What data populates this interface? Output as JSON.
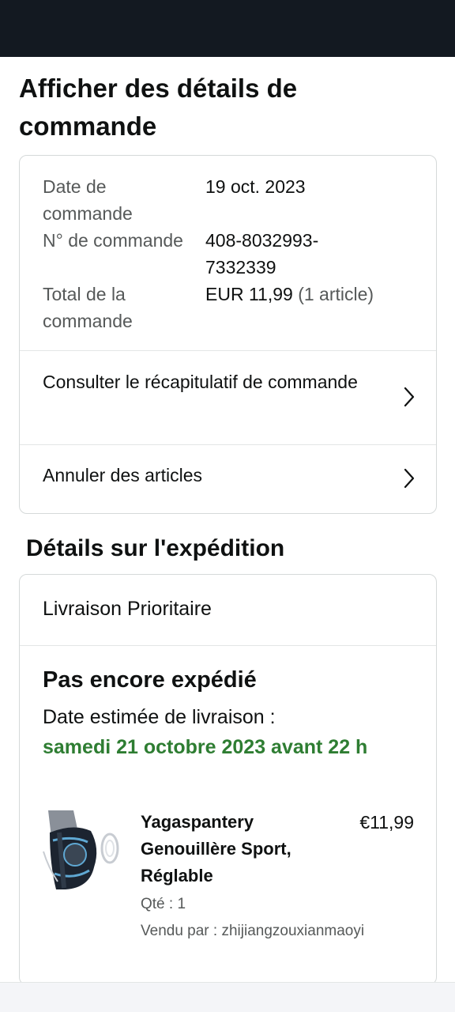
{
  "page_title": "Afficher des détails de commande",
  "summary": {
    "order_date_label": "Date de commande",
    "order_date": "19 oct. 2023",
    "order_number_label": "N° de commande",
    "order_number": "408-8032993-7332339",
    "total_label": "Total de la commande",
    "total_amount": "EUR 11,99",
    "total_items": "(1 article)"
  },
  "actions": {
    "recap_label": "Consulter le récapitulatif de commande",
    "cancel_label": "Annuler des articles"
  },
  "shipping": {
    "section_title": "Détails sur l'expédition",
    "method": "Livraison Prioritaire",
    "status": "Pas encore expédié",
    "estimate_label": "Date estimée de livraison :",
    "estimate_date": "samedi 21 octobre 2023 avant 22 h",
    "estimate_color": "#2e7d32"
  },
  "product": {
    "name": "Yagaspantery Genouillère Sport, Réglable",
    "price": "€11,99",
    "quantity": "Qté : 1",
    "seller": "Vendu par : zhijiangzouxianmaoyi"
  }
}
